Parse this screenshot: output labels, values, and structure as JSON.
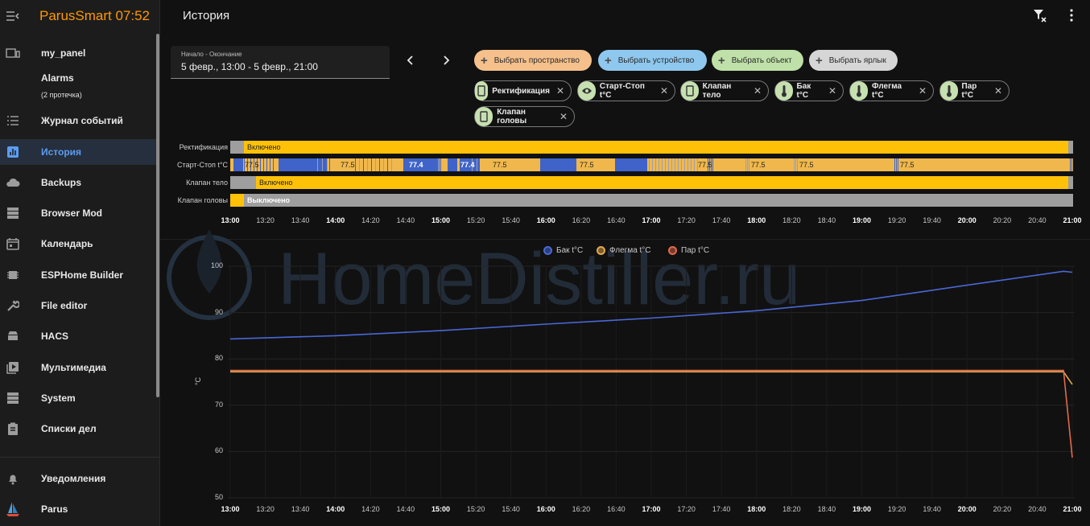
{
  "app": {
    "title": "ParusSmart 07:52"
  },
  "sidebar": {
    "items": [
      {
        "label": "my_panel",
        "icon": "panel-icon"
      },
      {
        "label": "Alarms",
        "sub": "(2 протечка)",
        "icon": ""
      },
      {
        "label": "Журнал событий",
        "icon": "list-icon"
      },
      {
        "label": "История",
        "icon": "chart-bar-icon",
        "active": true
      },
      {
        "label": "Backups",
        "icon": "cloud-icon"
      },
      {
        "label": "Browser Mod",
        "icon": "server-icon"
      },
      {
        "label": "Календарь",
        "icon": "calendar-icon"
      },
      {
        "label": "ESPHome Builder",
        "icon": "chip-icon"
      },
      {
        "label": "File editor",
        "icon": "wrench-icon"
      },
      {
        "label": "HACS",
        "icon": "hacs-icon"
      },
      {
        "label": "Мультимедиа",
        "icon": "play-icon"
      },
      {
        "label": "System",
        "icon": "server-icon"
      },
      {
        "label": "Списки дел",
        "icon": "clipboard-icon"
      }
    ],
    "bottom": [
      {
        "label": "Уведомления",
        "icon": "bell-icon"
      },
      {
        "label": "Parus",
        "icon": "sailboat-icon"
      }
    ]
  },
  "header": {
    "title": "История"
  },
  "date_picker": {
    "label": "Начало - Окончание",
    "value": "5 февр., 13:00 - 5 февр., 21:00"
  },
  "pickers": [
    {
      "label": "Выбрать пространство",
      "color": "#f5c08b"
    },
    {
      "label": "Выбрать устройство",
      "color": "#8fc8ef"
    },
    {
      "label": "Выбрать объект",
      "color": "#bfe0a8"
    },
    {
      "label": "Выбрать ярлык",
      "color": "#d6d6d6"
    }
  ],
  "entities": [
    {
      "label": "Ректификация",
      "icon": "device-icon"
    },
    {
      "label": "Старт-Стоп t°C",
      "icon": "eye-icon"
    },
    {
      "label": "Клапан тело",
      "icon": "device-icon"
    },
    {
      "label": "Бак t°C",
      "icon": "thermometer-icon"
    },
    {
      "label": "Флегма t°C",
      "icon": "thermometer-icon"
    },
    {
      "label": "Пар t°C",
      "icon": "thermometer-icon"
    },
    {
      "label": "Клапан головы",
      "icon": "device-icon"
    }
  ],
  "timeline": {
    "rows": [
      {
        "label": "Ректификация",
        "text": "Включено"
      },
      {
        "label": "Старт-Стоп t°C",
        "values": [
          "77.5",
          "77.5",
          "77.4",
          "77.4",
          "77.5",
          "77.5",
          "77.5",
          "77.5",
          "77.5",
          "77.5"
        ]
      },
      {
        "label": "Клапан тело",
        "text": "Включено"
      },
      {
        "label": "Клапан головы",
        "text": "Выключено"
      }
    ],
    "ticks": [
      "13:00",
      "13:20",
      "13:40",
      "14:00",
      "14:20",
      "14:40",
      "15:00",
      "15:20",
      "15:40",
      "16:00",
      "16:20",
      "16:40",
      "17:00",
      "17:20",
      "17:40",
      "18:00",
      "18:20",
      "18:40",
      "19:00",
      "19:20",
      "19:40",
      "20:00",
      "20:20",
      "20:40",
      "21:00"
    ],
    "bold_ticks": [
      "13:00",
      "14:00",
      "15:00",
      "16:00",
      "17:00",
      "18:00",
      "19:00",
      "20:00",
      "21:00"
    ],
    "colors": {
      "on": "#ffc107",
      "off": "#9e9e9e",
      "val_orange": "#f0b84c",
      "val_blue": "#3f63c8"
    }
  },
  "chart_data": {
    "type": "line",
    "ylabel": "°C",
    "ylim": [
      50,
      100
    ],
    "yticks": [
      "100",
      "90",
      "80",
      "70",
      "60",
      "50"
    ],
    "x": [
      "13:00",
      "14:00",
      "15:00",
      "16:00",
      "17:00",
      "18:00",
      "19:00",
      "20:00",
      "20:55",
      "21:00"
    ],
    "series": [
      {
        "name": "Бак t°C",
        "color": "#4a68d6",
        "values": [
          84.3,
          85.0,
          86.1,
          87.5,
          88.8,
          90.4,
          92.6,
          95.9,
          98.9,
          98.7
        ]
      },
      {
        "name": "Флегма t°C",
        "color": "#e0a84e",
        "values": [
          77.2,
          77.2,
          77.2,
          77.2,
          77.2,
          77.2,
          77.2,
          77.2,
          77.2,
          74.5
        ]
      },
      {
        "name": "Пар t°C",
        "color": "#e06a4e",
        "values": [
          77.5,
          77.5,
          77.5,
          77.5,
          77.5,
          77.5,
          77.5,
          77.5,
          77.5,
          58.7
        ]
      }
    ]
  },
  "watermark": "HomeDistiller.ru"
}
